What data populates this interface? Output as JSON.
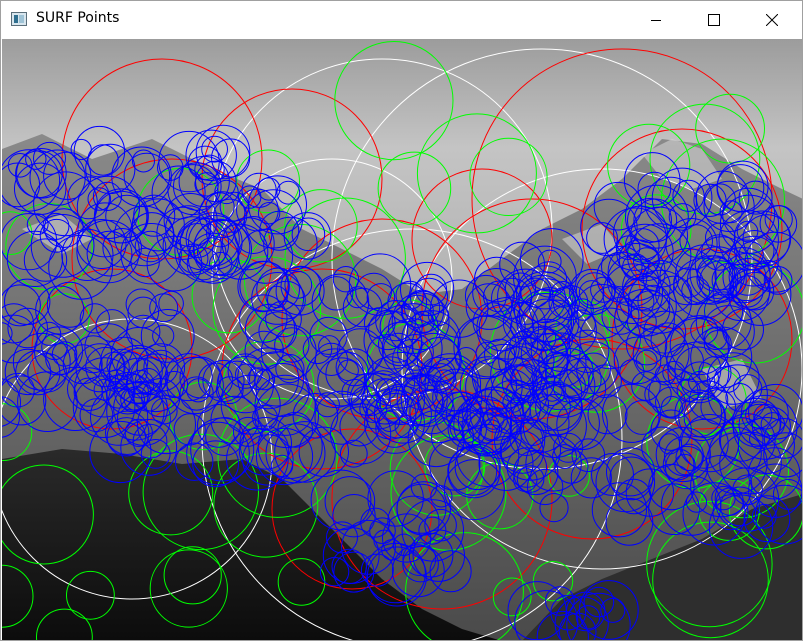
{
  "window": {
    "title": "SURF Points",
    "controls": [
      "minimize-icon",
      "maximize-icon",
      "close-icon"
    ]
  },
  "image": {
    "description_colors": {
      "sky": "#b9b9b9",
      "forest": "#1c1c1c",
      "keypoint_white": "#ffffff",
      "keypoint_red": "#ff0000",
      "keypoint_green": "#00ff00",
      "keypoint_blue": "#0000ff"
    }
  }
}
